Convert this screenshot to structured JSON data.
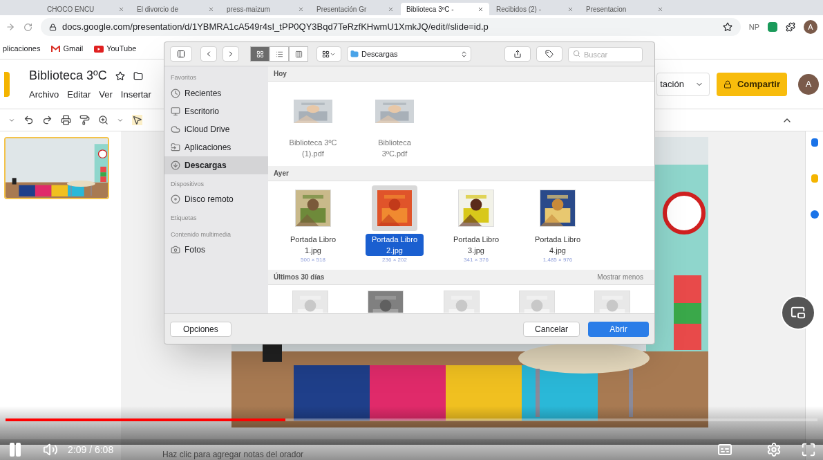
{
  "browser": {
    "tabs": [
      {
        "title": "CHOCO ENCU",
        "selected": false
      },
      {
        "title": "El divorcio de",
        "selected": false
      },
      {
        "title": "press-maizum",
        "selected": false
      },
      {
        "title": "Presentación Gr",
        "selected": false
      },
      {
        "title": "Biblioteca 3ºC -",
        "selected": true
      },
      {
        "title": "Recibidos (2) -",
        "selected": false
      },
      {
        "title": "Presentacion",
        "selected": false
      }
    ],
    "url": "docs.google.com/presentation/d/1YBMRA1cA549r4sI_tPP0QY3Bqd7TeRzfKHwmU1XmkJQ/edit#slide=id.p",
    "extension_label": "NP",
    "profile_initial": "A",
    "bookmarks": [
      {
        "label": "plicaciones",
        "kind": "plain"
      },
      {
        "label": "Gmail",
        "kind": "gmail"
      },
      {
        "label": "YouTube",
        "kind": "youtube"
      }
    ]
  },
  "docs": {
    "title": "Biblioteca 3ºC",
    "menus": [
      "Archivo",
      "Editar",
      "Ver",
      "Insertar"
    ],
    "present_label": "tación",
    "share_label": "Compartir",
    "avatar": "A",
    "speaker_notes": "Haz clic para agregar notas del orador"
  },
  "dialog": {
    "view_modes": [
      {
        "selected": true
      },
      {
        "selected": false
      },
      {
        "selected": false
      }
    ],
    "location": "Descargas",
    "search": {
      "placeholder": "Buscar"
    },
    "sidebar": [
      {
        "heading": "Favoritos",
        "items": [
          {
            "label": "Recientes",
            "selected": false
          },
          {
            "label": "Escritorio",
            "selected": false
          },
          {
            "label": "iCloud Drive",
            "selected": false
          },
          {
            "label": "Aplicaciones",
            "selected": false
          },
          {
            "label": "Descargas",
            "selected": true
          }
        ]
      },
      {
        "heading": "Dispositivos",
        "items": [
          {
            "label": "Disco remoto",
            "selected": false
          }
        ]
      },
      {
        "heading": "Etiquetas"
      },
      {
        "heading": "Contenido multimedia",
        "items": [
          {
            "label": "Fotos",
            "selected": false
          }
        ]
      }
    ],
    "groups": [
      {
        "heading": "Hoy",
        "files": [
          {
            "name": "Biblioteca 3ºC (1).pdf",
            "selected": false
          },
          {
            "name": "Biblioteca 3ºC.pdf",
            "selected": false
          }
        ]
      },
      {
        "heading": "Ayer",
        "files": [
          {
            "name": "Portada Libro 1.jpg",
            "dimensions": "500 × 518",
            "selected": false
          },
          {
            "name": "Portada Libro 2.jpg",
            "dimensions": "236 × 202",
            "selected": true
          },
          {
            "name": "Portada Libro 3.jpg",
            "dimensions": "341 × 376",
            "selected": false
          },
          {
            "name": "Portada Libro 4.jpg",
            "dimensions": "1,485 × 976",
            "selected": false
          }
        ]
      },
      {
        "heading": "Últimos 30 días",
        "action": "Mostrar menos"
      }
    ],
    "options_label": "Opciones",
    "cancel_label": "Cancelar",
    "open_label": "Abrir"
  },
  "video": {
    "time": "2:09 / 6:08",
    "level": 0.345
  }
}
